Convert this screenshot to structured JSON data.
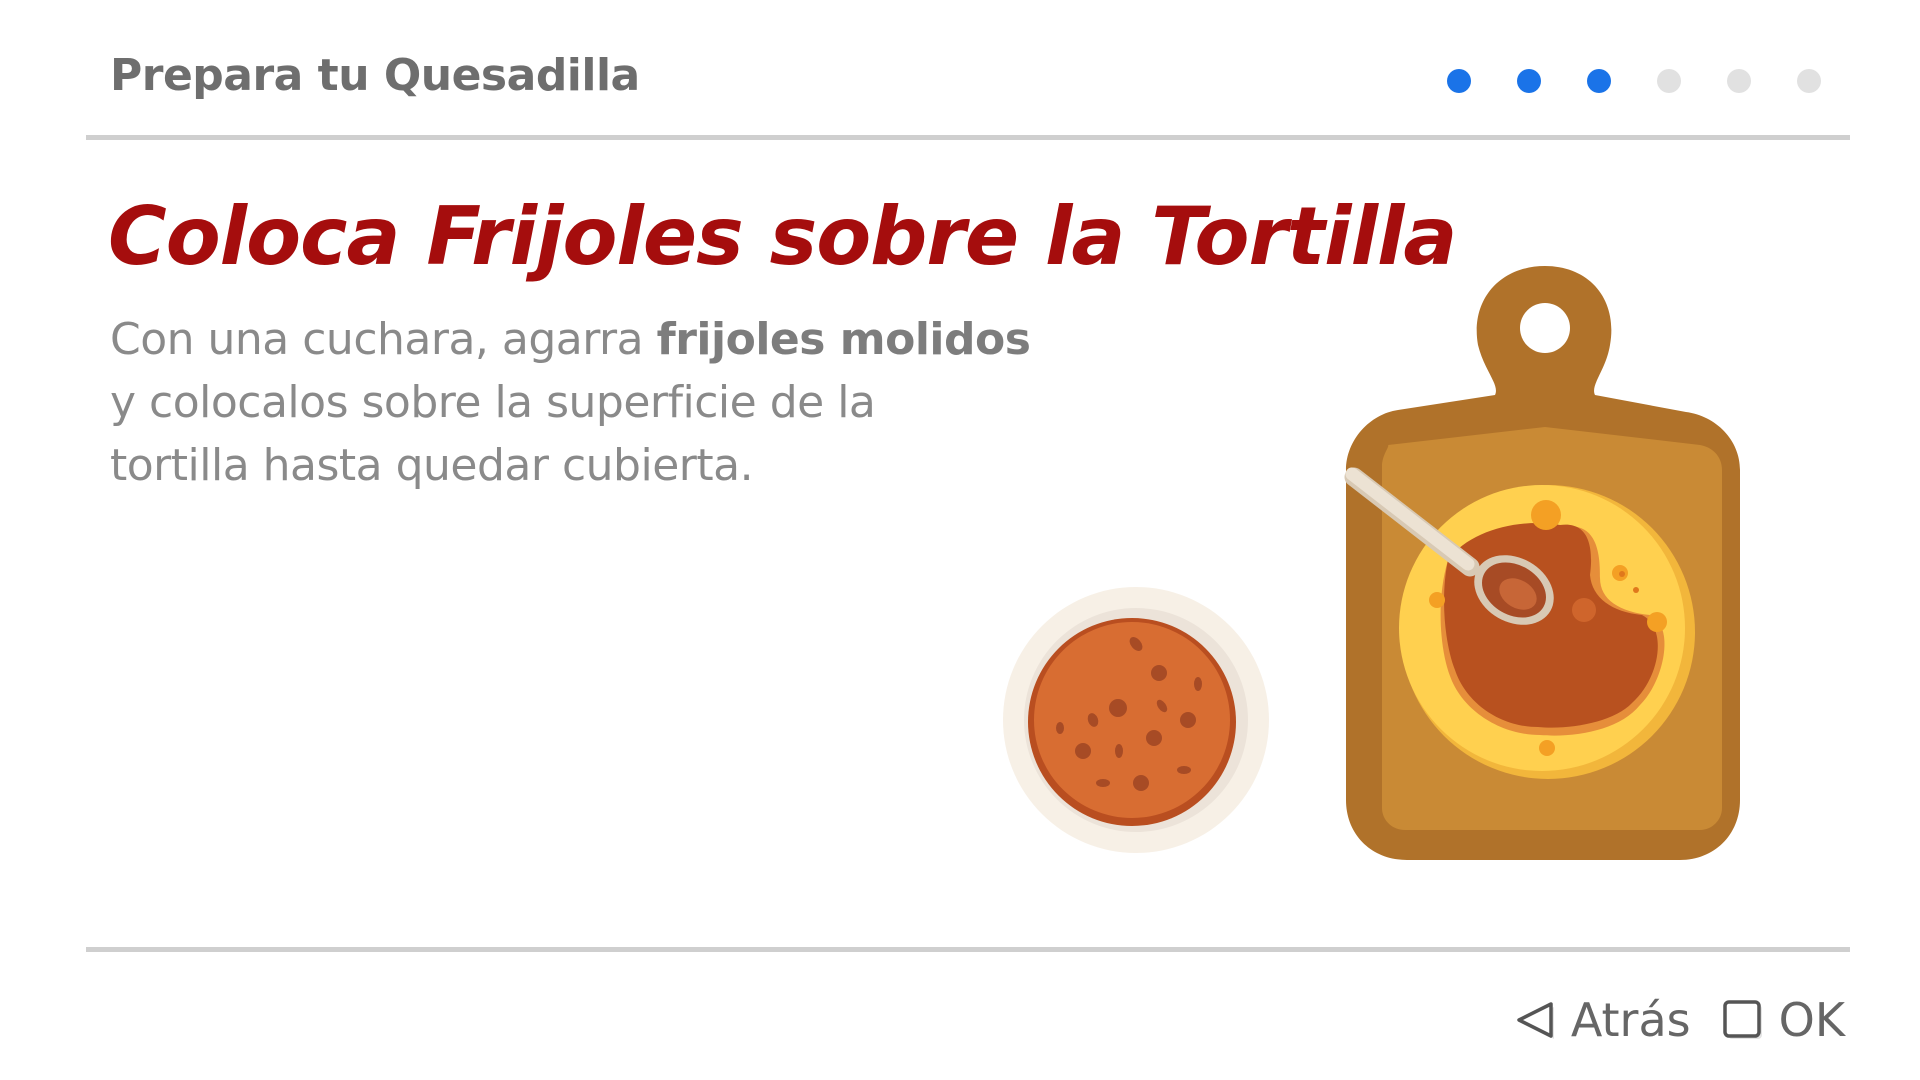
{
  "header": {
    "title": "Prepara tu Quesadilla"
  },
  "progress": {
    "total_steps": 6,
    "completed_steps": 3,
    "active_color": "#1a73e8",
    "inactive_color": "#e1e1e1"
  },
  "step": {
    "title": "Coloca Frijoles sobre la Tortilla",
    "instruction_prefix": "Con una cuchara, agarra ",
    "instruction_bold": "frijoles molidos",
    "instruction_line2": "y colocalos sobre la superficie de la",
    "instruction_line3": "tortilla hasta quedar cubierta.",
    "title_color": "#a50d0d"
  },
  "illustration": {
    "icons": [
      "bean-bowl-icon",
      "cutting-board-icon",
      "tortilla-icon",
      "spoon-icon"
    ]
  },
  "footer": {
    "back_label": "Atrás",
    "ok_label": "OK",
    "back_icon": "triangle-left-icon",
    "ok_icon": "square-icon"
  }
}
